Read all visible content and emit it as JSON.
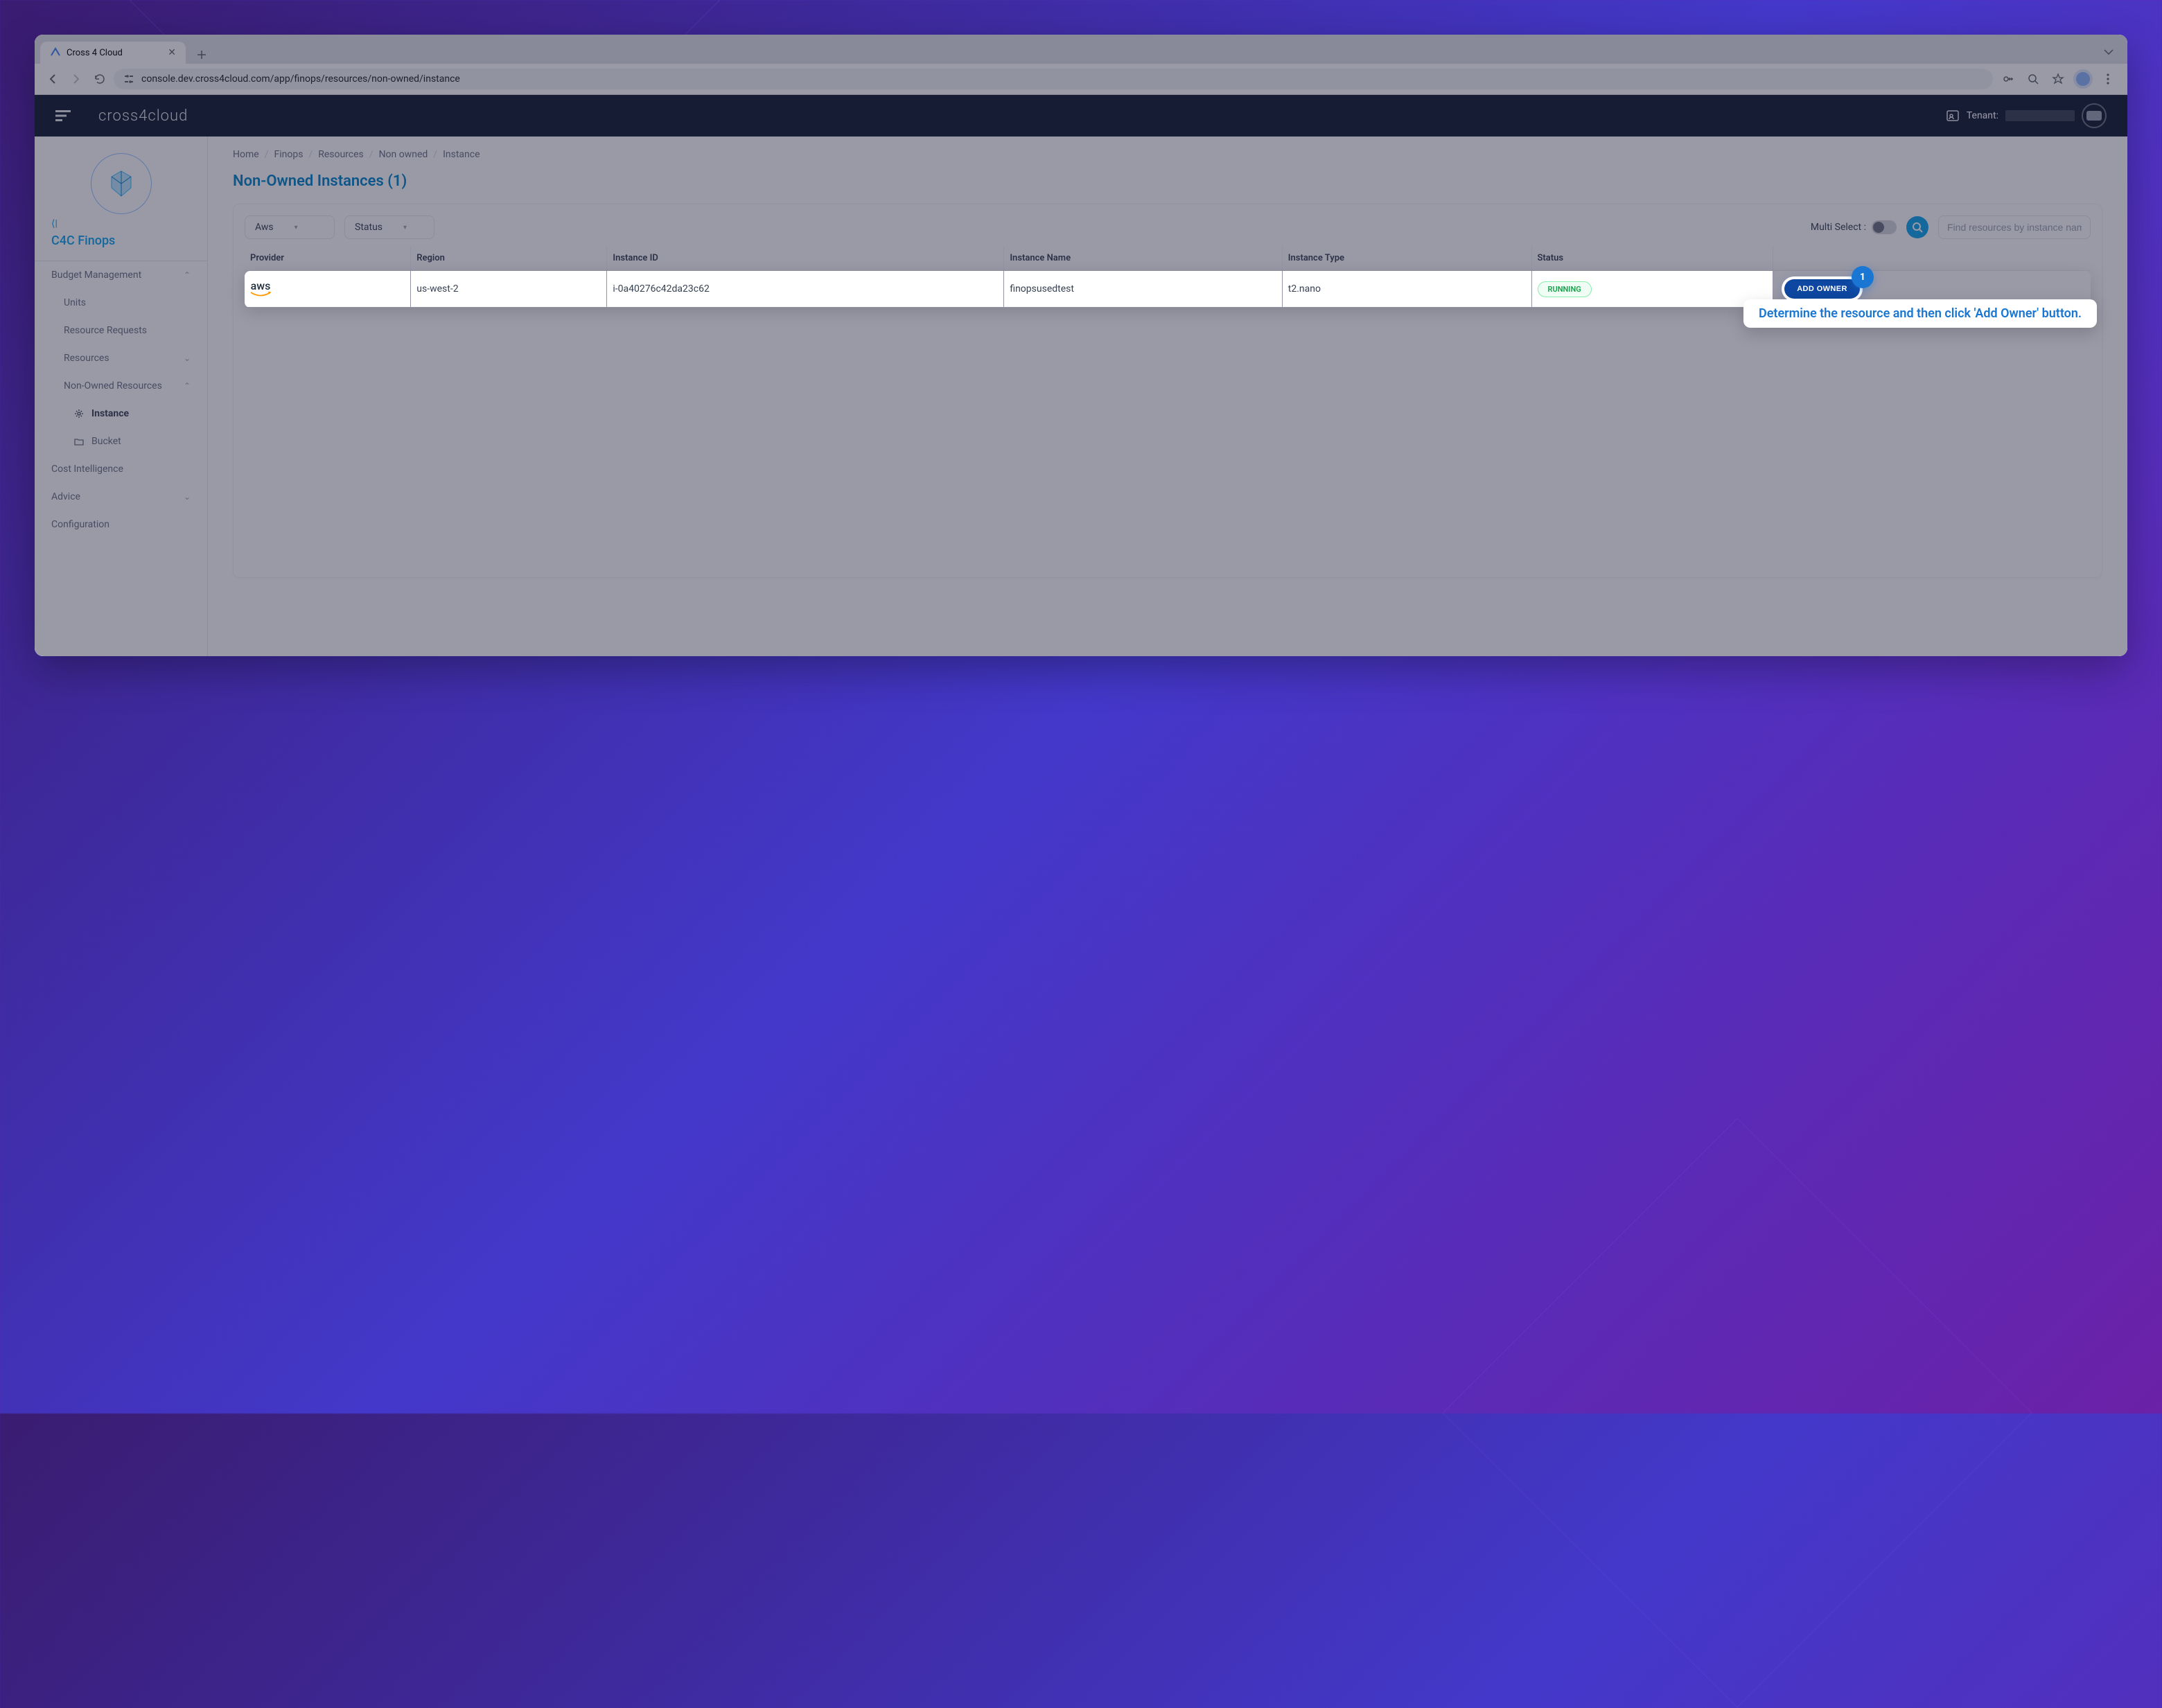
{
  "browser": {
    "tab_title": "Cross 4 Cloud",
    "url": "console.dev.cross4cloud.com/app/finops/resources/non-owned/instance"
  },
  "header": {
    "brand": "cross4cloud",
    "tenant_label": "Tenant:"
  },
  "sidebar": {
    "collapse_label": "⟨|",
    "module_title": "C4C Finops",
    "items": {
      "budget": {
        "label": "Budget Management",
        "expanded": true
      },
      "units": {
        "label": "Units"
      },
      "resource_requests": {
        "label": "Resource Requests"
      },
      "resources": {
        "label": "Resources",
        "expanded": false
      },
      "non_owned": {
        "label": "Non-Owned Resources",
        "expanded": true
      },
      "instance": {
        "label": "Instance"
      },
      "bucket": {
        "label": "Bucket"
      },
      "cost_intel": {
        "label": "Cost Intelligence"
      },
      "advice": {
        "label": "Advice",
        "expanded": false
      },
      "configuration": {
        "label": "Configuration"
      }
    }
  },
  "breadcrumbs": [
    "Home",
    "Finops",
    "Resources",
    "Non owned",
    "Instance"
  ],
  "page": {
    "title": "Non-Owned Instances (1)"
  },
  "toolbar": {
    "filter_provider": "Aws",
    "filter_status": "Status",
    "multi_select_label": "Multi Select :",
    "search_placeholder": "Find resources by instance name"
  },
  "table": {
    "headers": [
      "Provider",
      "Region",
      "Instance ID",
      "Instance Name",
      "Instance Type",
      "Status"
    ],
    "row": {
      "provider": "aws",
      "region": "us-west-2",
      "instance_id": "i-0a40276c42da23c62",
      "instance_name": "finopsusedtest",
      "instance_type": "t2.nano",
      "status": "RUNNING",
      "action_label": "ADD OWNER"
    }
  },
  "callout": {
    "badge": "1",
    "text": "Determine the resource and then click 'Add Owner' button."
  }
}
